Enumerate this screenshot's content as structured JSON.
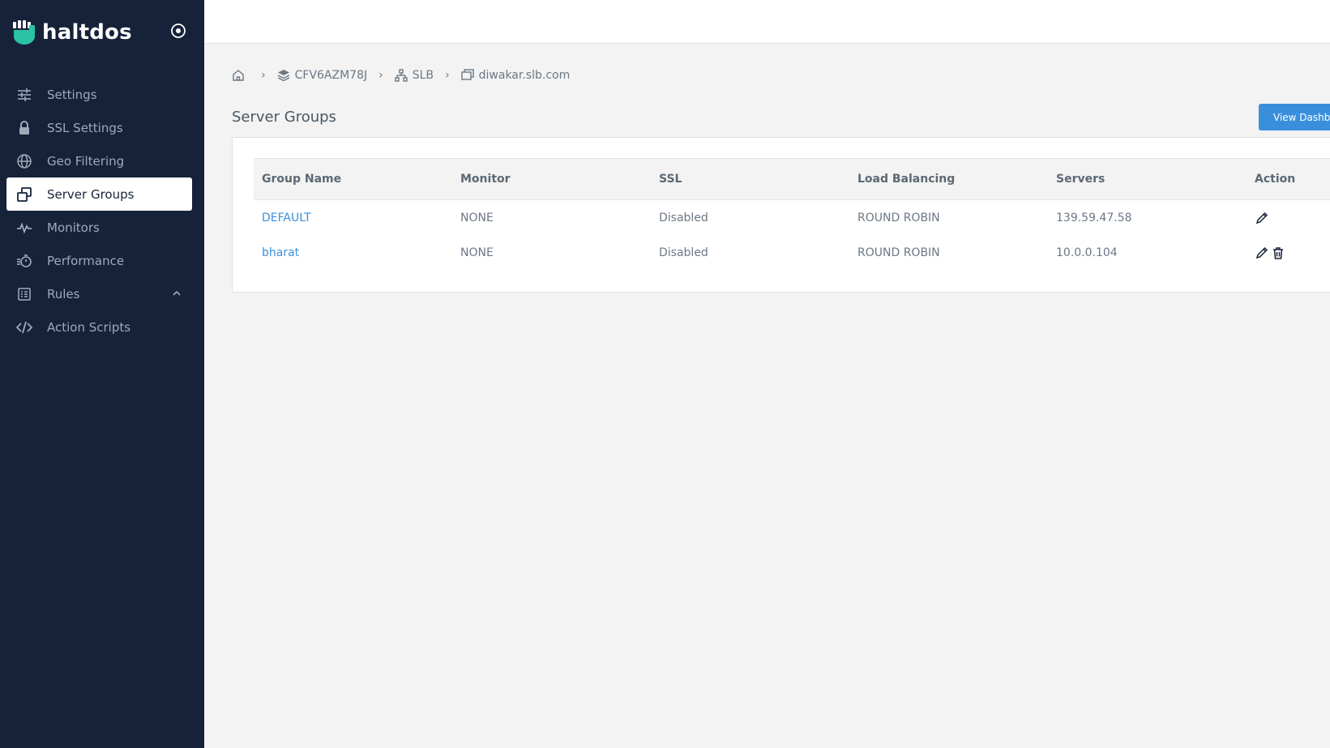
{
  "brand": {
    "name": "haltdos"
  },
  "sidebar": {
    "items": [
      {
        "label": "Settings"
      },
      {
        "label": "SSL Settings"
      },
      {
        "label": "Geo Filtering"
      },
      {
        "label": "Server Groups"
      },
      {
        "label": "Monitors"
      },
      {
        "label": "Performance"
      },
      {
        "label": "Rules"
      },
      {
        "label": "Action Scripts"
      }
    ]
  },
  "breadcrumb": {
    "items": [
      {
        "label": "CFV6AZM78J"
      },
      {
        "label": "SLB"
      },
      {
        "label": "diwakar.slb.com"
      }
    ]
  },
  "page": {
    "title": "Server Groups",
    "view_button": "View Dashbo"
  },
  "table": {
    "headers": [
      "Group Name",
      "Monitor",
      "SSL",
      "Load Balancing",
      "Servers",
      "Action"
    ],
    "rows": [
      {
        "group": "DEFAULT",
        "monitor": "NONE",
        "ssl": "Disabled",
        "lb": "ROUND ROBIN",
        "servers": "139.59.47.58"
      },
      {
        "group": "bharat",
        "monitor": "NONE",
        "ssl": "Disabled",
        "lb": "ROUND ROBIN",
        "servers": "10.0.0.104"
      }
    ]
  },
  "colors": {
    "sidebar": "#16223a",
    "accent": "#3a8fdc",
    "brand_icon": "#2bc1a4"
  }
}
